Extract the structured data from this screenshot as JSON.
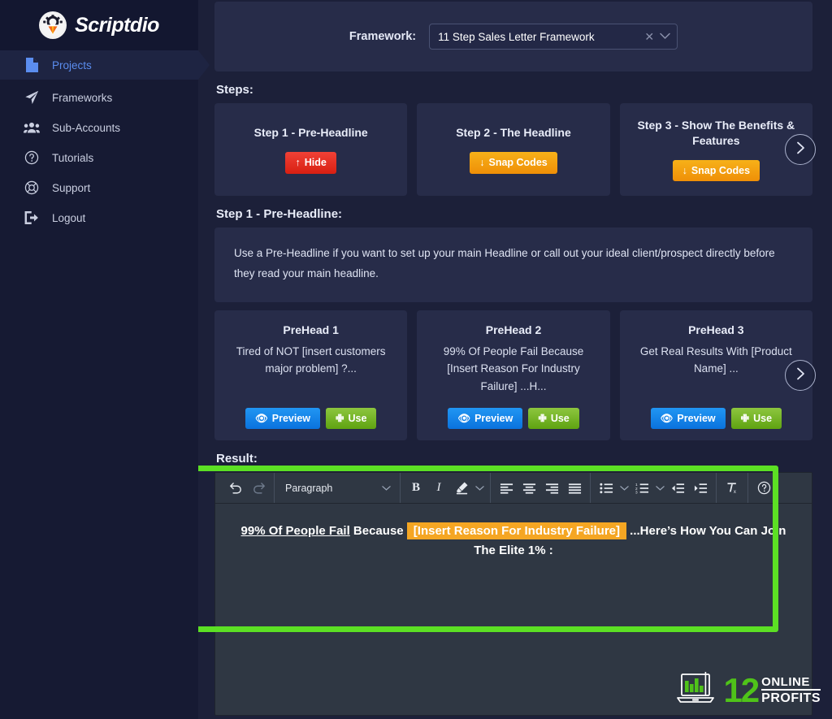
{
  "brand": {
    "name": "Scriptdio",
    "logo_icon": "gear-tulip-logo-icon"
  },
  "sidebar": {
    "items": [
      {
        "label": "Projects",
        "icon": "document-icon",
        "active": true
      },
      {
        "label": "Frameworks",
        "icon": "paper-plane-icon",
        "active": false
      },
      {
        "label": "Sub-Accounts",
        "icon": "users-group-icon",
        "active": false
      },
      {
        "label": "Tutorials",
        "icon": "question-circle-icon",
        "active": false
      },
      {
        "label": "Support",
        "icon": "life-ring-icon",
        "active": false
      },
      {
        "label": "Logout",
        "icon": "logout-icon",
        "active": false
      }
    ]
  },
  "framework": {
    "label": "Framework:",
    "value": "11 Step Sales Letter Framework",
    "clear_icon": "close-x-icon",
    "caret_icon": "chevron-down-icon"
  },
  "steps": {
    "heading": "Steps:",
    "cards": [
      {
        "title": "Step 1 - Pre-Headline",
        "button": "Hide",
        "button_icon": "arrow-up-icon",
        "button_style": "red"
      },
      {
        "title": "Step 2 - The Headline",
        "button": "Snap Codes",
        "button_icon": "arrow-down-icon",
        "button_style": "orange"
      },
      {
        "title": "Step 3 - Show The Benefits & Features",
        "button": "Snap Codes",
        "button_icon": "arrow-down-icon",
        "button_style": "orange"
      }
    ],
    "next_icon": "chevron-right-icon"
  },
  "step_detail": {
    "heading": "Step 1 - Pre-Headline:",
    "description": "Use a Pre-Headline if you want to set up your main Headline or call out your ideal client/prospect directly before they read your main headline."
  },
  "preheads": {
    "cards": [
      {
        "title": "PreHead 1",
        "text": "Tired of NOT    [insert customers major problem] ?...",
        "preview_label": "Preview",
        "preview_icon": "eye-icon",
        "use_label": "Use",
        "use_icon": "plus-icon"
      },
      {
        "title": "PreHead 2",
        "text": "99% Of People Fail Because [Insert Reason For Industry Failure]    ...H...",
        "preview_label": "Preview",
        "preview_icon": "eye-icon",
        "use_label": "Use",
        "use_icon": "plus-icon"
      },
      {
        "title": "PreHead 3",
        "text": "Get Real Results With [Product Name]    ...",
        "preview_label": "Preview",
        "preview_icon": "eye-icon",
        "use_label": "Use",
        "use_icon": "plus-icon"
      }
    ],
    "next_icon": "chevron-right-icon"
  },
  "result": {
    "heading": "Result:",
    "toolbar": {
      "undo_icon": "undo-arrow-icon",
      "redo_icon": "redo-arrow-icon",
      "block_format": "Paragraph",
      "block_caret_icon": "chevron-down-icon",
      "bold_label": "B",
      "italic_label": "I",
      "highlight_icon": "highlighter-pen-icon",
      "highlight_caret_icon": "chevron-down-icon",
      "align_left_icon": "align-left-icon",
      "align_center_icon": "align-center-icon",
      "align_right_icon": "align-right-icon",
      "align_justify_icon": "align-justify-icon",
      "bullet_list_icon": "bullet-list-icon",
      "bullet_caret_icon": "chevron-down-icon",
      "numbered_list_icon": "numbered-list-icon",
      "numbered_caret_icon": "chevron-down-icon",
      "outdent_icon": "outdent-icon",
      "indent_icon": "indent-icon",
      "clear_format_icon": "clear-formatting-icon",
      "help_icon": "question-circle-icon"
    },
    "body": {
      "underlined": "99% Of People Fail",
      "plain_1": " Because ",
      "highlighted": "[Insert Reason For Industry Failure]",
      "plain_2": "  ...Here’s How You Can Join The Elite 1% :"
    }
  },
  "watermark": {
    "number": "12",
    "line1": "ONLINE",
    "line2": "PROFITS",
    "icon": "laptop-bar-chart-icon"
  },
  "colors": {
    "page_bg": "#1c2039",
    "sidebar_bg": "#161a33",
    "card_bg": "#272c49",
    "accent_blue": "#5b8def",
    "editor_bg": "#2f3743",
    "highlight_orange": "#f5a623",
    "annotation_green": "#5ce024",
    "hide_red": "#e5281b",
    "snap_orange": "#f2a00d",
    "use_green": "#7ab929",
    "watermark_green": "#4fc319"
  }
}
